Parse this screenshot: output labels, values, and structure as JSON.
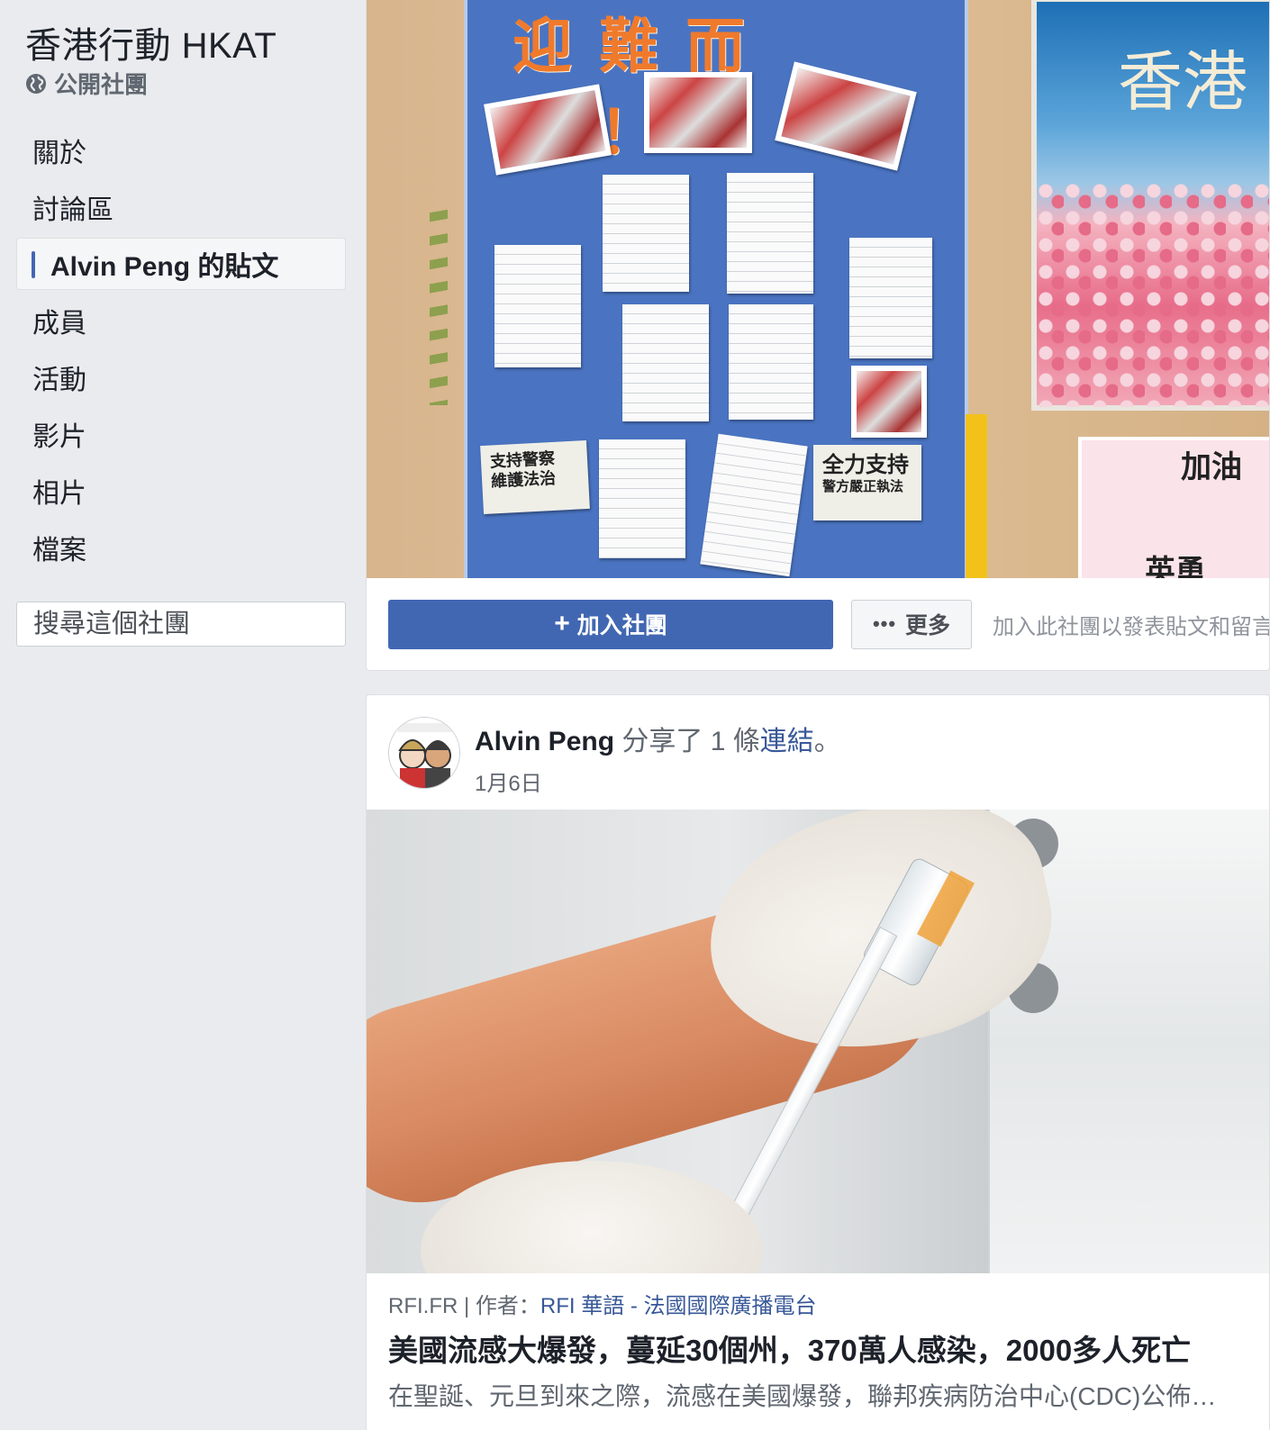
{
  "group": {
    "title": "香港行動 HKAT",
    "privacy_label": "公開社團"
  },
  "sidebar": {
    "items": [
      {
        "label": "關於"
      },
      {
        "label": "討論區"
      },
      {
        "label": "Alvin Peng 的貼文",
        "active": true
      },
      {
        "label": "成員"
      },
      {
        "label": "活動"
      },
      {
        "label": "影片"
      },
      {
        "label": "相片"
      },
      {
        "label": "檔案"
      }
    ],
    "search_placeholder": "搜尋這個社團"
  },
  "cover": {
    "board_title": "迎難而上！",
    "sign_text_1": "支持警察",
    "sign_text_2": "維護法治",
    "sign_text_3": "全力支持",
    "sign_text_4": "警方嚴正執法",
    "poster_title": "香港",
    "pink_text_1": "加油",
    "pink_text_2": "英勇",
    "join_button": "加入社團",
    "join_icon": "plus-icon",
    "more_button": "更多",
    "more_icon": "ellipsis-icon",
    "join_hint": "加入此社團以發表貼文和留言"
  },
  "post": {
    "author": "Alvin Peng",
    "shared_text": " 分享了 1 條",
    "link_word": "連結",
    "shared_suffix": "。",
    "date": "1月6日",
    "link": {
      "domain": "RFI.FR",
      "separator": " | 作者：",
      "source_author": "RFI 華語 - 法國國際廣播電台",
      "title": "美國流感大爆發，蔓延30個州，370萬人感染，2000多人死亡",
      "description": "在聖誕、元旦到來之際，流感在美國爆發，聯邦疾病防治中心(CDC)公佈的數據顯示"
    }
  },
  "colors": {
    "accent": "#4267b2",
    "link": "#385898",
    "background": "#e9ebee"
  }
}
